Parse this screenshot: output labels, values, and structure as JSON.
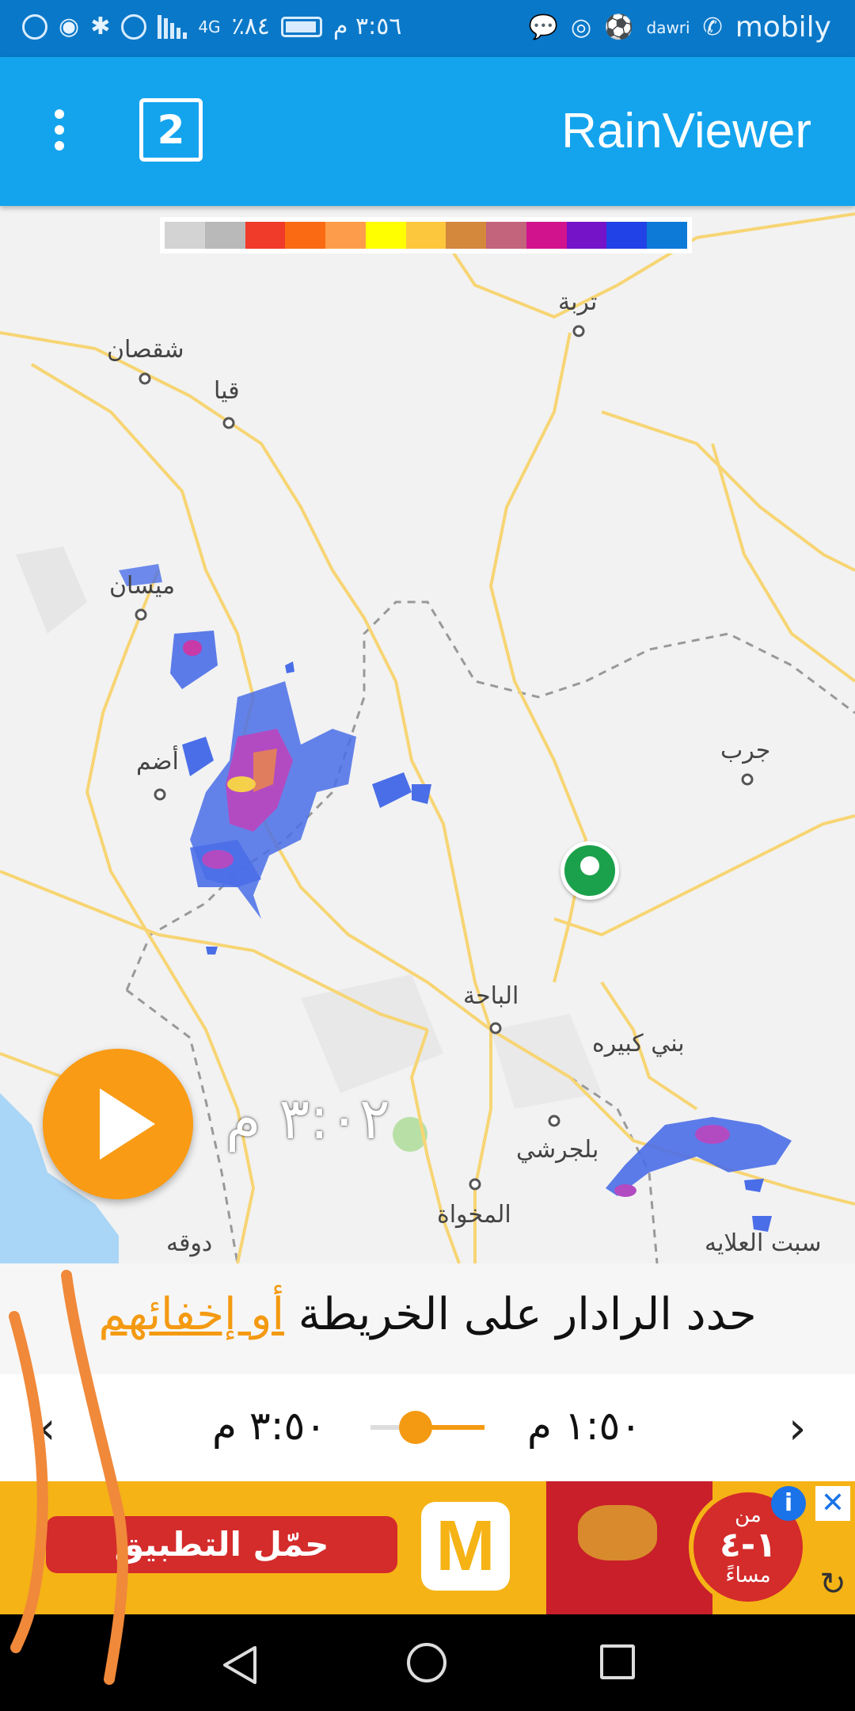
{
  "status_bar": {
    "time": "٣:٥٦ م",
    "battery": "٨٤٪",
    "network": "4G",
    "carrier": "mobily",
    "app_badge": "dawri"
  },
  "app_bar": {
    "title": "RainViewer",
    "layer_button_label": "2"
  },
  "legend": {
    "colors": [
      "#d3d3d3",
      "#b9b9b9",
      "#f03a2a",
      "#f96a12",
      "#fd9d4b",
      "#ffff00",
      "#fdc73d",
      "#d3883c",
      "#c3637c",
      "#d1138e",
      "#7413c8",
      "#2142e6",
      "#0e7ad8"
    ]
  },
  "map": {
    "places": [
      {
        "name": "تربة"
      },
      {
        "name": "شقصان"
      },
      {
        "name": "قيا"
      },
      {
        "name": "ميسان"
      },
      {
        "name": "أضم"
      },
      {
        "name": "جرب"
      },
      {
        "name": "الباحة"
      },
      {
        "name": "بني كبيره"
      },
      {
        "name": "بلجرشي"
      },
      {
        "name": "المخواة"
      },
      {
        "name": "دوقه"
      },
      {
        "name": "سبت العلايه"
      }
    ],
    "frame_time": "٣:٠٢ م"
  },
  "hint": {
    "text": "حدد الرادار على الخريطة ",
    "link": "أو إخفائهم"
  },
  "timeline": {
    "start_time": "١:٥٠ م",
    "end_time": "٣:٥٠ م",
    "prev_arrow": "‹",
    "next_arrow": "›",
    "position": 0.35
  },
  "ad": {
    "button_label": "حمّل التطبيق",
    "logo": "M",
    "badge_top": "من",
    "badge_main": "١-٤",
    "badge_bottom": "مساءً",
    "info": "i",
    "close": "✕",
    "refresh": "↻"
  }
}
